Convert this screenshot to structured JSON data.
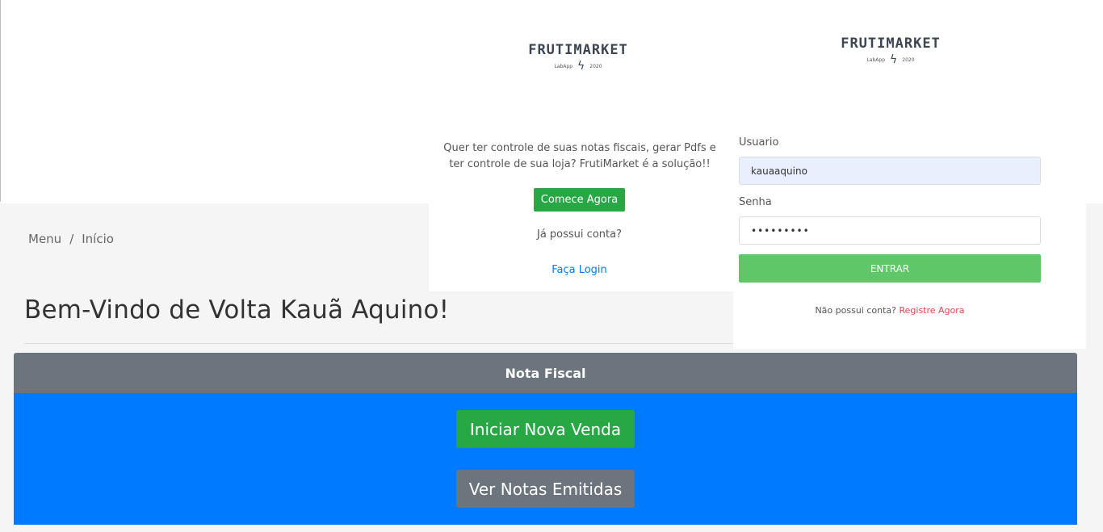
{
  "breadcrumb": {
    "root": "Menu",
    "separator": "/",
    "current": "Início"
  },
  "welcome": "Bem-Vindo de Volta Kauã Aquino!",
  "card": {
    "header": "Nota Fiscal",
    "primary_button": "Iniciar Nova Venda",
    "secondary_button": "Ver Notas Emitidas"
  },
  "landing": {
    "logo_text": "FRUTIMARKET",
    "logo_sub_left": "LabApp",
    "logo_sub_right": "2020",
    "description": "Quer ter controle de suas notas fiscais, gerar Pdfs e ter controle de sua loja? FrutiMarket é a solução!!",
    "cta_button": "Comece Agora",
    "have_account": "Já possui conta?",
    "login_link": "Faça Login"
  },
  "login": {
    "logo_text": "FRUTIMARKET",
    "logo_sub_left": "LabApp",
    "logo_sub_right": "2020",
    "user_label": "Usuario",
    "user_value": "kauaaquino",
    "password_label": "Senha",
    "password_value": "•••••••••",
    "submit_button": "ENTRAR",
    "no_account": "Não possui conta?",
    "register_link": "Registre Agora"
  },
  "colors": {
    "primary_blue": "#007bff",
    "success_green": "#28a745",
    "secondary_gray": "#6c757d",
    "enter_green": "#5fc768",
    "register_red": "#e8434f"
  }
}
